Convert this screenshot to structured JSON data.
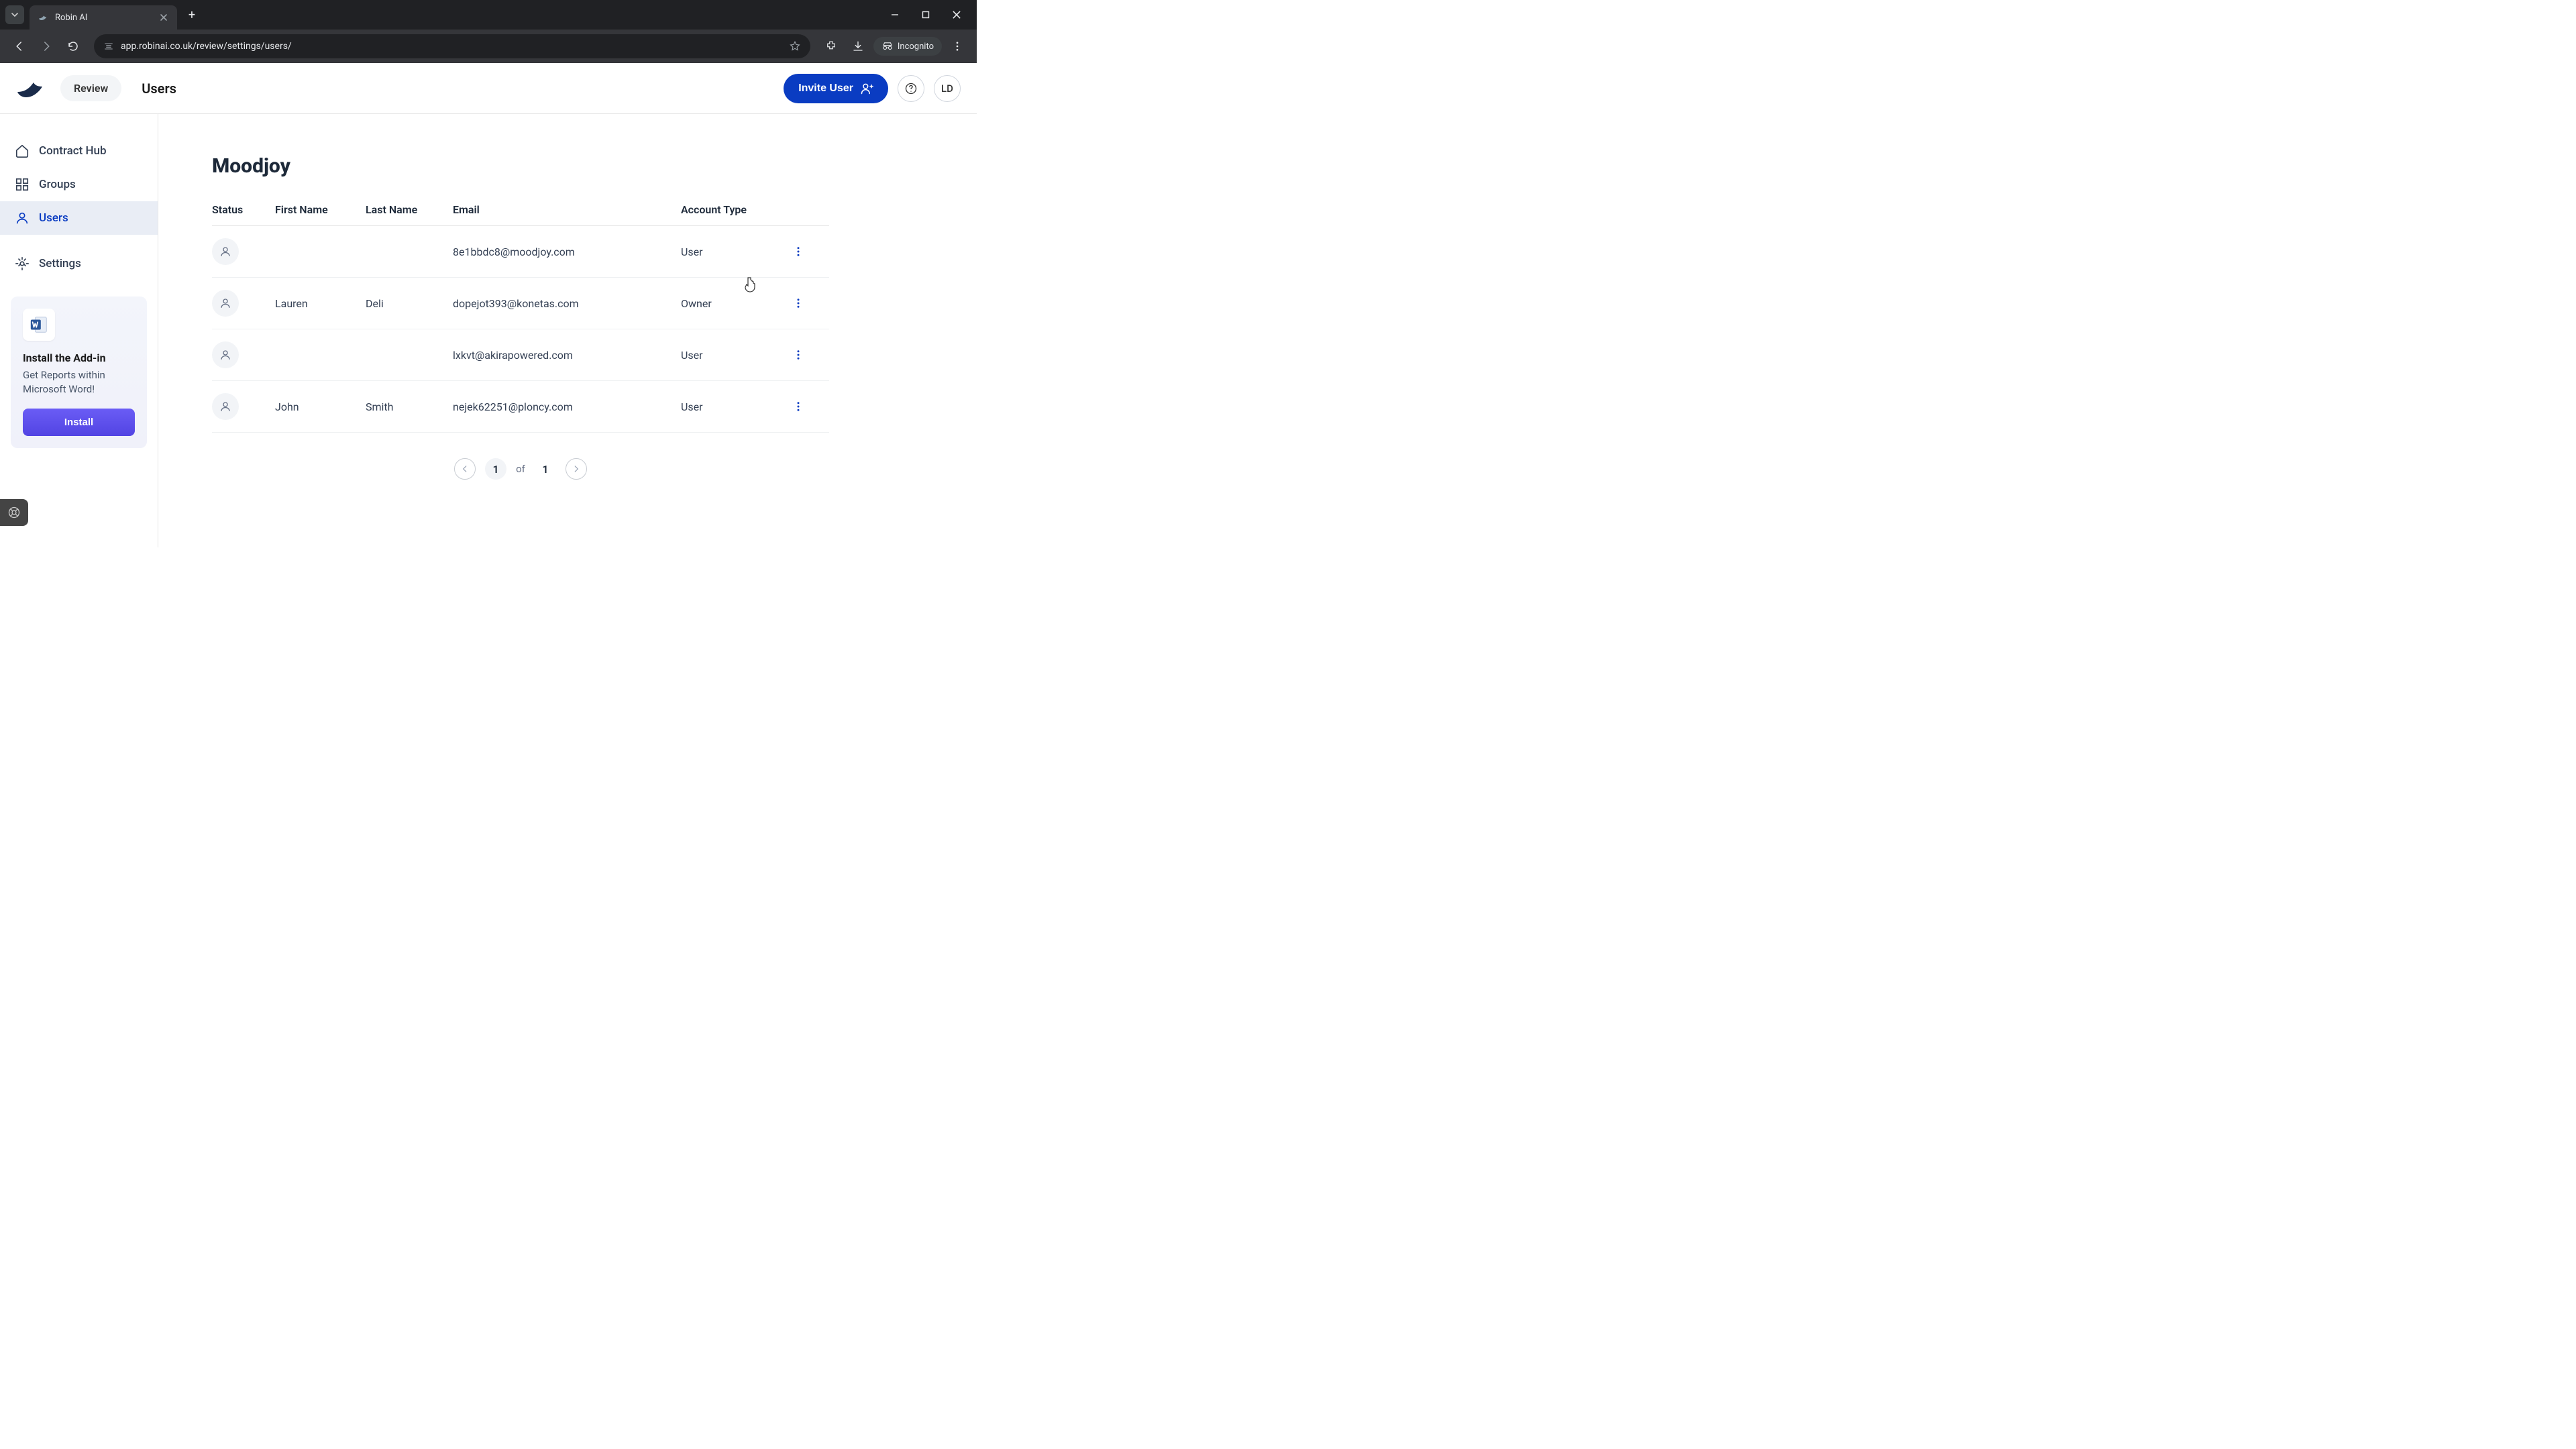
{
  "browser": {
    "tab_title": "Robin AI",
    "url": "app.robinai.co.uk/review/settings/users/",
    "incognito_label": "Incognito"
  },
  "header": {
    "review_label": "Review",
    "page_title": "Users",
    "invite_label": "Invite User",
    "avatar_initials": "LD"
  },
  "sidebar": {
    "items": [
      {
        "label": "Contract Hub"
      },
      {
        "label": "Groups"
      },
      {
        "label": "Users"
      },
      {
        "label": "Settings"
      }
    ],
    "addin": {
      "title": "Install the Add-in",
      "subtitle": "Get Reports within Microsoft Word!",
      "button": "Install"
    }
  },
  "main": {
    "org_name": "Moodjoy",
    "columns": {
      "status": "Status",
      "first_name": "First Name",
      "last_name": "Last Name",
      "email": "Email",
      "account_type": "Account Type"
    },
    "rows": [
      {
        "first_name": "",
        "last_name": "",
        "email": "8e1bbdc8@moodjoy.com",
        "account_type": "User"
      },
      {
        "first_name": "Lauren",
        "last_name": "Deli",
        "email": "dopejot393@konetas.com",
        "account_type": "Owner"
      },
      {
        "first_name": "",
        "last_name": "",
        "email": "lxkvt@akirapowered.com",
        "account_type": "User"
      },
      {
        "first_name": "John",
        "last_name": "Smith",
        "email": "nejek62251@ploncy.com",
        "account_type": "User"
      }
    ],
    "pagination": {
      "current": "1",
      "of_label": "of",
      "total": "1"
    }
  }
}
